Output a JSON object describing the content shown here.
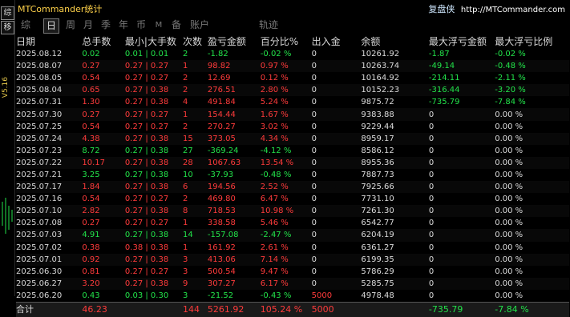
{
  "colors": {
    "background": "#000000",
    "profit": "#22e34a",
    "loss": "#ff3b3b",
    "title": "#ffd24a"
  },
  "side": {
    "btn1": "综",
    "btn2": "移",
    "version": "V5.16"
  },
  "title": {
    "app": "MTCommander统计",
    "brand_cn": "复盘侠",
    "brand_url": "http://MTCommander.com"
  },
  "tabs": [
    "综",
    "日",
    "周",
    "月",
    "季",
    "年",
    "币",
    "M",
    "备",
    "账户",
    "轨迹"
  ],
  "active_tab": "日",
  "headers": [
    "日期",
    "总手数",
    "最小|大手数",
    "次数",
    "盈亏金额",
    "百分比%",
    "出入金",
    "余额",
    "最大浮亏金额",
    "最大浮亏比例"
  ],
  "rows": [
    [
      "2025.08.12",
      "0.02",
      "0.01 | 0.01",
      "2",
      "-1.82",
      "-0.02 %",
      "0",
      "10261.92",
      "-1.87",
      "-0.02 %",
      "g"
    ],
    [
      "2025.08.07",
      "0.27",
      "0.27 | 0.27",
      "1",
      "98.82",
      "0.97 %",
      "0",
      "10263.74",
      "-49.14",
      "-0.48 %",
      "r"
    ],
    [
      "2025.08.05",
      "0.54",
      "0.27 | 0.27",
      "2",
      "12.69",
      "0.12 %",
      "0",
      "10164.92",
      "-214.11",
      "-2.11 %",
      "r"
    ],
    [
      "2025.08.04",
      "0.65",
      "0.27 | 0.38",
      "2",
      "276.51",
      "2.80 %",
      "0",
      "10152.23",
      "-316.44",
      "-3.20 %",
      "r"
    ],
    [
      "2025.07.31",
      "1.30",
      "0.27 | 0.38",
      "4",
      "491.84",
      "5.24 %",
      "0",
      "9875.72",
      "-735.79",
      "-7.84 %",
      "r"
    ],
    [
      "2025.07.30",
      "0.27",
      "0.27 | 0.27",
      "1",
      "154.44",
      "1.67 %",
      "0",
      "9383.88",
      "0",
      "0.00 %",
      "r"
    ],
    [
      "2025.07.25",
      "0.54",
      "0.27 | 0.27",
      "2",
      "270.27",
      "3.02 %",
      "0",
      "9229.44",
      "0",
      "0.00 %",
      "r"
    ],
    [
      "2025.07.24",
      "4.38",
      "0.27 | 0.38",
      "15",
      "373.05",
      "4.34 %",
      "0",
      "8959.17",
      "0",
      "0.00 %",
      "r"
    ],
    [
      "2025.07.23",
      "8.72",
      "0.27 | 0.38",
      "27",
      "-369.24",
      "-4.12 %",
      "0",
      "8586.12",
      "0",
      "0.00 %",
      "g"
    ],
    [
      "2025.07.22",
      "10.17",
      "0.27 | 0.38",
      "28",
      "1067.63",
      "13.54 %",
      "0",
      "8955.36",
      "0",
      "0.00 %",
      "r"
    ],
    [
      "2025.07.21",
      "3.25",
      "0.27 | 0.38",
      "10",
      "-37.93",
      "-0.48 %",
      "0",
      "7887.73",
      "0",
      "0.00 %",
      "g"
    ],
    [
      "2025.07.17",
      "1.84",
      "0.27 | 0.38",
      "6",
      "194.56",
      "2.52 %",
      "0",
      "7925.66",
      "0",
      "0.00 %",
      "r"
    ],
    [
      "2025.07.16",
      "0.54",
      "0.27 | 0.27",
      "2",
      "469.80",
      "6.47 %",
      "0",
      "7731.10",
      "0",
      "0.00 %",
      "r"
    ],
    [
      "2025.07.10",
      "2.82",
      "0.27 | 0.38",
      "8",
      "718.53",
      "10.98 %",
      "0",
      "7261.30",
      "0",
      "0.00 %",
      "r"
    ],
    [
      "2025.07.08",
      "0.27",
      "0.27 | 0.27",
      "1",
      "338.58",
      "5.46 %",
      "0",
      "6542.77",
      "0",
      "0.00 %",
      "r"
    ],
    [
      "2025.07.03",
      "4.91",
      "0.27 | 0.38",
      "14",
      "-157.08",
      "-2.47 %",
      "0",
      "6204.19",
      "0",
      "0.00 %",
      "g"
    ],
    [
      "2025.07.02",
      "0.38",
      "0.38 | 0.38",
      "1",
      "161.92",
      "2.61 %",
      "0",
      "6361.27",
      "0",
      "0.00 %",
      "r"
    ],
    [
      "2025.07.01",
      "0.92",
      "0.27 | 0.38",
      "3",
      "413.06",
      "7.14 %",
      "0",
      "6199.35",
      "0",
      "0.00 %",
      "r"
    ],
    [
      "2025.06.30",
      "0.81",
      "0.27 | 0.27",
      "3",
      "500.54",
      "9.47 %",
      "0",
      "5786.29",
      "0",
      "0.00 %",
      "r"
    ],
    [
      "2025.06.27",
      "3.20",
      "0.27 | 0.38",
      "9",
      "307.27",
      "6.17 %",
      "0",
      "5285.75",
      "0",
      "0.00 %",
      "r"
    ],
    [
      "2025.06.20",
      "0.43",
      "0.03 | 0.30",
      "3",
      "-21.52",
      "-0.43 %",
      "5000",
      "4978.48",
      "0",
      "0.00 %",
      "g"
    ]
  ],
  "totals": [
    "合计",
    "46.23",
    "",
    "144",
    "5261.92",
    "105.24 %",
    "5000",
    "",
    "-735.79",
    "-7.84 %"
  ]
}
